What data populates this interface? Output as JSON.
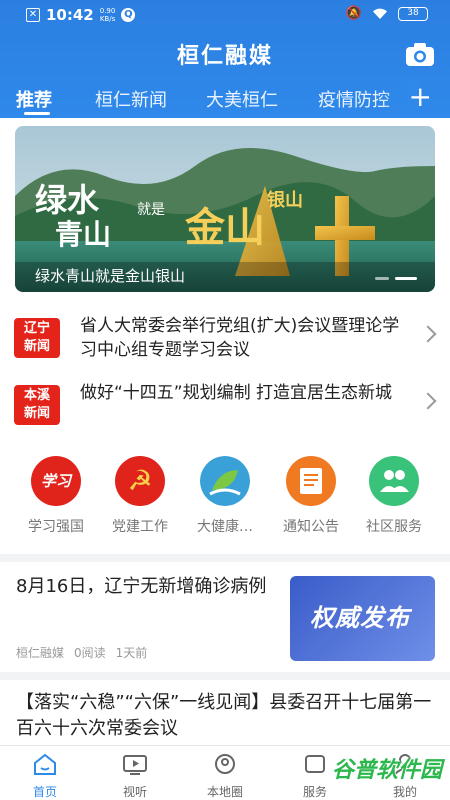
{
  "status_bar": {
    "time": "10:42",
    "net_speed_value": "0.90",
    "net_speed_unit": "KB/s",
    "battery": "38"
  },
  "header": {
    "app_title": "桓仁融媒",
    "camera_icon": "camera-icon"
  },
  "tabs": [
    {
      "label": "推荐",
      "active": true
    },
    {
      "label": "桓仁新闻",
      "active": false
    },
    {
      "label": "大美桓仁",
      "active": false
    },
    {
      "label": "疫情防控",
      "active": false
    }
  ],
  "banner": {
    "overlay_text_1": "绿水",
    "overlay_text_2": "青山",
    "overlay_text_3": "就是",
    "overlay_text_4": "金山",
    "overlay_text_5": "银山",
    "caption": "绿水青山就是金山银山"
  },
  "top_news": [
    {
      "badge_line1": "辽宁",
      "badge_line2": "新闻",
      "title": "省人大常委会举行党组(扩大)会议暨理论学习中心组专题学习会议"
    },
    {
      "badge_line1": "本溪",
      "badge_line2": "新闻",
      "title": "做好“十四五”规划编制 打造宜居生态新城"
    }
  ],
  "services": [
    {
      "label": "学习强国",
      "icon": "xuexi-qiangguo-icon",
      "color": "#e0241c",
      "glyph": "学习"
    },
    {
      "label": "党建工作",
      "icon": "party-emblem-icon",
      "color": "#e0241c",
      "glyph": "☭"
    },
    {
      "label": "大健康…",
      "icon": "health-leaf-icon",
      "color": "#3aa0d8",
      "glyph": ""
    },
    {
      "label": "通知公告",
      "icon": "notice-icon",
      "color": "#f07a22",
      "glyph": ""
    },
    {
      "label": "社区服务",
      "icon": "community-icon",
      "color": "#39c27a",
      "glyph": ""
    }
  ],
  "article": {
    "title": "8月16日，辽宁无新增确诊病例",
    "source": "桓仁融媒",
    "reads": "0阅读",
    "time": "1天前",
    "thumb_text": "权威发布"
  },
  "article2": {
    "title": "【落实“六稳”“六保”一线见闻】县委召开十七届第一百六十六次常委会议"
  },
  "bottom_nav": [
    {
      "label": "首页",
      "icon": "home-icon",
      "active": true
    },
    {
      "label": "视听",
      "icon": "video-icon",
      "active": false
    },
    {
      "label": "本地圈",
      "icon": "local-circle-icon",
      "active": false
    },
    {
      "label": "服务",
      "icon": "service-icon",
      "active": false
    },
    {
      "label": "我的",
      "icon": "profile-icon",
      "active": false
    }
  ],
  "watermark": "谷普软件园"
}
